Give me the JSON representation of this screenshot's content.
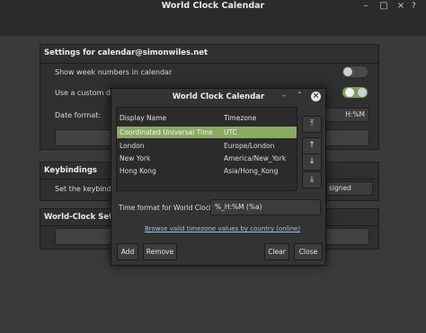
{
  "window": {
    "title": "World Clock Calendar"
  },
  "settings": {
    "section1_title": "Settings for calendar@simonwiles.net",
    "week_numbers_label": "Show week numbers in calendar",
    "custom_date_label": "Use a custom date",
    "date_format_label": "Date format:",
    "date_format_value": "H:%M",
    "section2_title": "Keybindings",
    "keybinding_label": "Set the keybinding",
    "keybinding_value": "signed",
    "section3_title": "World-Clock Settings"
  },
  "dialog": {
    "title": "World Clock Calendar",
    "col_display": "Display Name",
    "col_timezone": "Timezone",
    "rows": [
      {
        "name": "Coordinated Universal Time",
        "tz": "UTC"
      },
      {
        "name": "London",
        "tz": "Europe/London"
      },
      {
        "name": "New York",
        "tz": "America/New_York"
      },
      {
        "name": "Hong Kong",
        "tz": "Asia/Hong_Kong"
      }
    ],
    "time_format_label": "Time format for World Clocks",
    "time_format_value": "%_H:%M (%a)",
    "browse_link": "Browse valid timezone values by country (online)",
    "add": "Add",
    "remove": "Remove",
    "clear": "Clear",
    "close": "Close"
  },
  "colors": {
    "accent": "#8aaa63",
    "toggle_on": "#7ba05b"
  }
}
